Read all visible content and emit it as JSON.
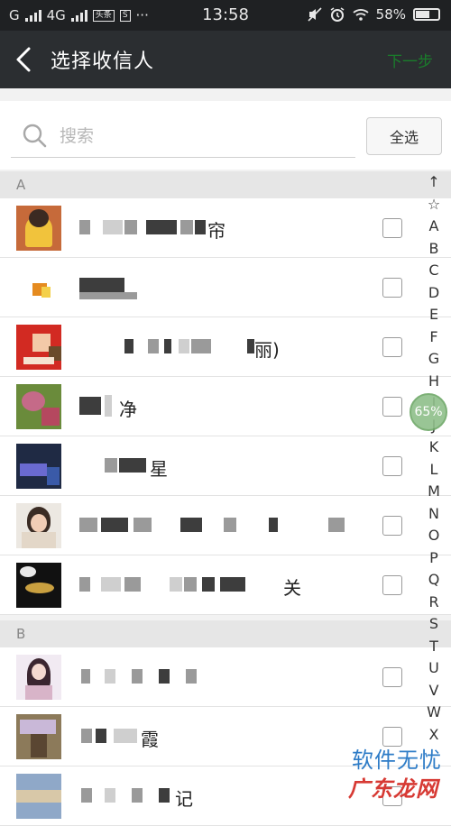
{
  "status_bar": {
    "carrier_1": "G",
    "carrier_2": "4G",
    "badge_1": "头条",
    "badge_2": "S",
    "more": "···",
    "time": "13:58",
    "battery": "58%"
  },
  "title_bar": {
    "title": "选择收信人",
    "next_label": "下一步"
  },
  "search": {
    "placeholder": "搜索",
    "value": "",
    "select_all_label": "全选"
  },
  "sections": [
    {
      "letter": "A",
      "contacts": [
        {
          "visible_name": "帘"
        },
        {
          "visible_name": ""
        },
        {
          "visible_name": "丽)"
        },
        {
          "visible_name": "净"
        },
        {
          "visible_name": "星"
        },
        {
          "visible_name": ""
        },
        {
          "visible_name": "关"
        }
      ]
    },
    {
      "letter": "B",
      "contacts": [
        {
          "visible_name": ""
        },
        {
          "visible_name": "霞"
        },
        {
          "visible_name": "记"
        }
      ]
    }
  ],
  "index_bar": [
    "↑",
    "☆",
    "A",
    "B",
    "C",
    "D",
    "E",
    "F",
    "G",
    "H",
    "I",
    "J",
    "K",
    "L",
    "M",
    "N",
    "O",
    "P",
    "Q",
    "R",
    "S",
    "T",
    "U",
    "V",
    "W",
    "X"
  ],
  "overlay": {
    "progress_label": "65%",
    "progress_value": 65
  },
  "watermark": {
    "line_1": "软件无忧",
    "line_2": "广东龙网"
  },
  "colors": {
    "accent_green": "#1a7d2b",
    "titlebar_bg": "#2b2e31",
    "statusbar_bg": "#1f2123"
  }
}
